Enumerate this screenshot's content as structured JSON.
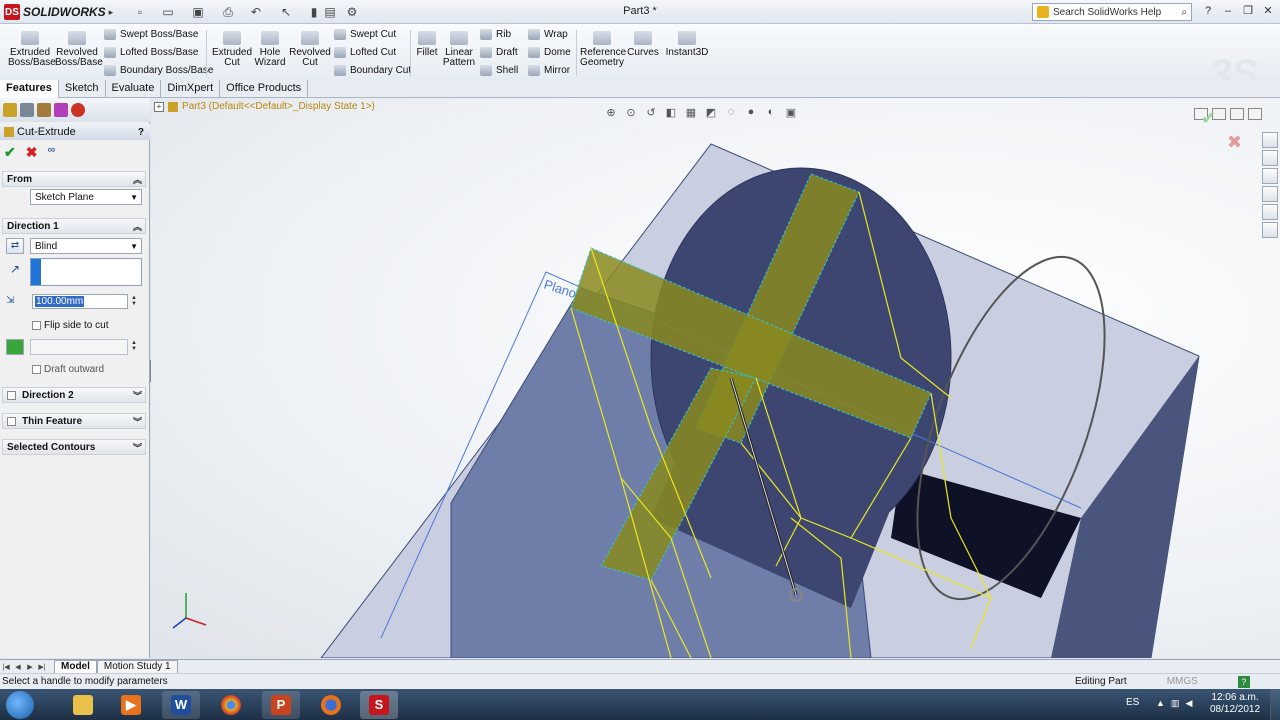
{
  "app": {
    "name": "SOLIDWORKS",
    "doc_title": "Part3 *",
    "help_search_placeholder": "Search SolidWorks Help"
  },
  "ribbon": {
    "extruded_boss": "Extruded Boss/Base",
    "revolved_boss": "Revolved Boss/Base",
    "swept_boss": "Swept Boss/Base",
    "lofted_boss": "Lofted Boss/Base",
    "boundary_boss": "Boundary Boss/Base",
    "extruded_cut": "Extruded Cut",
    "hole_wizard": "Hole Wizard",
    "revolved_cut": "Revolved Cut",
    "swept_cut": "Swept Cut",
    "lofted_cut": "Lofted Cut",
    "boundary_cut": "Boundary Cut",
    "fillet": "Fillet",
    "linear_pattern": "Linear Pattern",
    "rib": "Rib",
    "draft": "Draft",
    "shell": "Shell",
    "wrap": "Wrap",
    "dome": "Dome",
    "mirror": "Mirror",
    "reference_geometry": "Reference Geometry",
    "curves": "Curves",
    "instant3d": "Instant3D"
  },
  "tabs": [
    "Features",
    "Sketch",
    "Evaluate",
    "DimXpert",
    "Office Products"
  ],
  "panel": {
    "title": "Cut-Extrude",
    "help": "?",
    "from_header": "From",
    "from_value": "Sketch Plane",
    "direction1_header": "Direction 1",
    "end_condition": "Blind",
    "depth": "100.00mm",
    "flip_side": "Flip side to cut",
    "draft_outward": "Draft outward",
    "direction2_header": "Direction 2",
    "thin_feature_header": "Thin Feature",
    "selected_contours_header": "Selected Contours"
  },
  "viewport": {
    "tree_path": "Part3  (Default<<Default>_Display State 1>)",
    "plane_label": "Plano 1"
  },
  "bottom_tabs": [
    "Model",
    "Motion Study 1"
  ],
  "status": {
    "message": "Select a handle to modify parameters",
    "mode": "Editing Part",
    "units": "MMGS",
    "help": "?"
  },
  "taskbar": {
    "lang": "ES",
    "time": "12:06 a.m.",
    "date": "08/12/2012",
    "apps": [
      "explorer",
      "media-player",
      "word",
      "chrome",
      "powerpoint",
      "firefox",
      "solidworks"
    ]
  },
  "colors": {
    "part_face": "#6f7ea8",
    "preview_fill": "#8a8a1e",
    "preview_edge": "#e8e820",
    "selection_edge": "#28c6e6",
    "accent_blue": "#1f74d8"
  }
}
